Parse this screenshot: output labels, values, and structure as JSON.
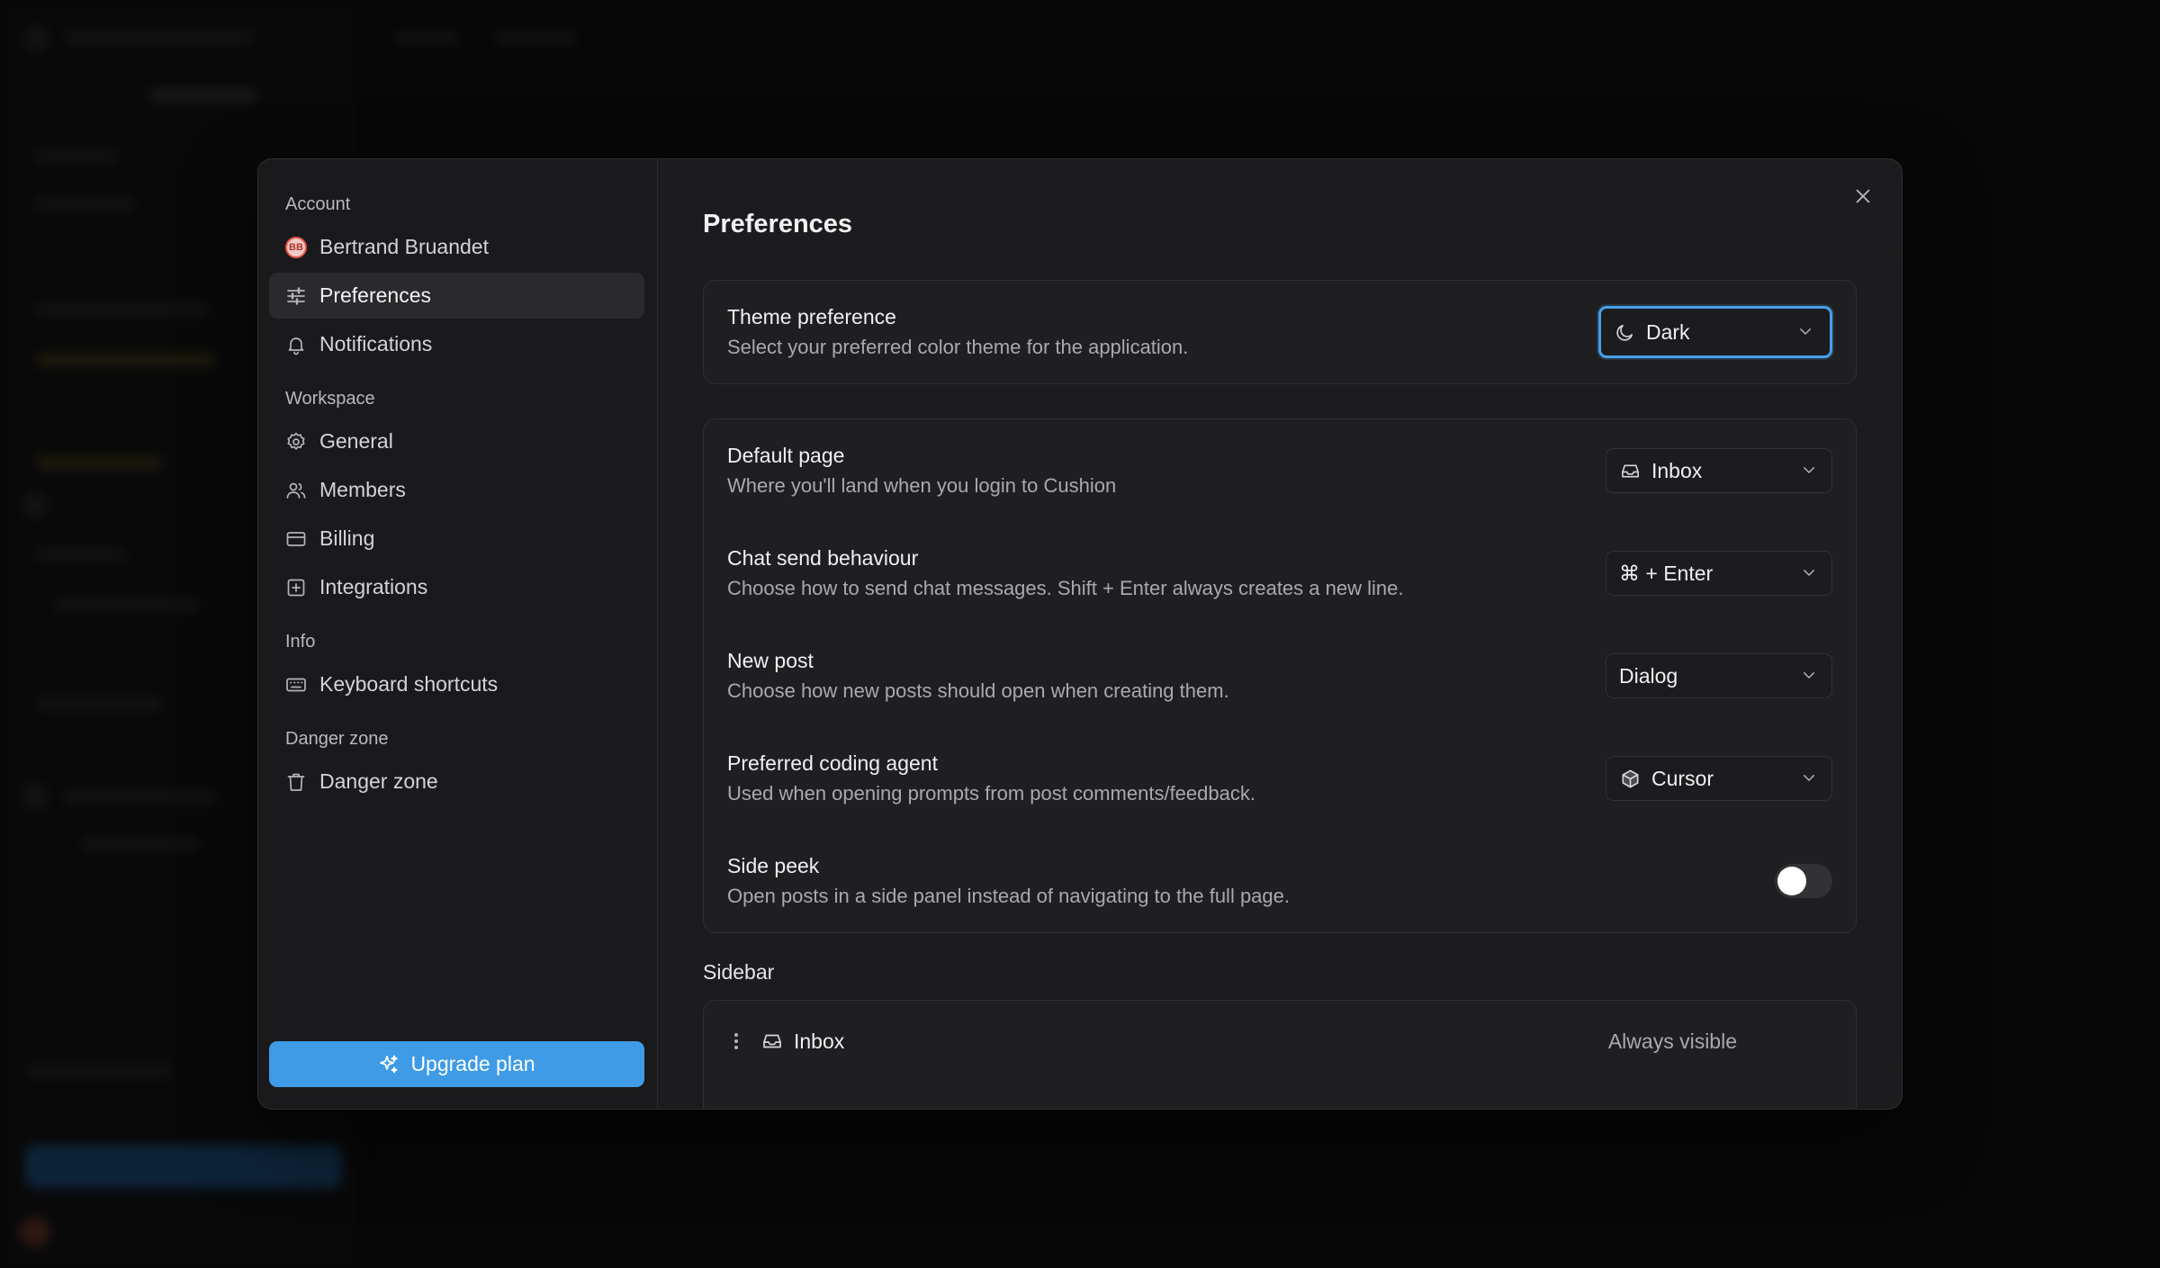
{
  "settings_nav": {
    "sections": [
      {
        "label": "Account",
        "items": [
          {
            "label": "Bertrand Bruandet",
            "icon": "user-avatar-icon",
            "initials": "BB"
          },
          {
            "label": "Preferences",
            "icon": "sliders-icon",
            "active": true
          },
          {
            "label": "Notifications",
            "icon": "bell-icon"
          }
        ]
      },
      {
        "label": "Workspace",
        "items": [
          {
            "label": "General",
            "icon": "gear-icon"
          },
          {
            "label": "Members",
            "icon": "users-icon"
          },
          {
            "label": "Billing",
            "icon": "credit-card-icon"
          },
          {
            "label": "Integrations",
            "icon": "plus-square-icon"
          }
        ]
      },
      {
        "label": "Info",
        "items": [
          {
            "label": "Keyboard shortcuts",
            "icon": "keyboard-icon"
          }
        ]
      },
      {
        "label": "Danger zone",
        "items": [
          {
            "label": "Danger zone",
            "icon": "trash-icon"
          }
        ]
      }
    ],
    "upgrade_label": "Upgrade plan"
  },
  "preferences": {
    "title": "Preferences",
    "theme": {
      "title": "Theme preference",
      "description": "Select your preferred color theme for the application.",
      "value": "Dark",
      "icon": "moon-icon"
    },
    "rows": [
      {
        "title": "Default page",
        "description": "Where you'll land when you login to Cushion",
        "value": "Inbox",
        "icon": "inbox-icon"
      },
      {
        "title": "Chat send behaviour",
        "description": "Choose how to send chat messages. Shift + Enter always creates a new line.",
        "value": "⌘ + Enter"
      },
      {
        "title": "New post",
        "description": "Choose how new posts should open when creating them.",
        "value": "Dialog"
      },
      {
        "title": "Preferred coding agent",
        "description": "Used when opening prompts from post comments/feedback.",
        "value": "Cursor",
        "icon": "cube-icon"
      }
    ],
    "side_peek": {
      "title": "Side peek",
      "description": "Open posts in a side panel instead of navigating to the full page.",
      "enabled": false
    },
    "sidebar_section": {
      "label": "Sidebar",
      "items": [
        {
          "name": "Inbox",
          "visibility": "Always visible",
          "icon": "inbox-icon"
        }
      ]
    }
  },
  "colors": {
    "accent": "#3f9be6",
    "modal_bg": "#1c1c1e",
    "focus_ring": "#4a9fe8"
  }
}
